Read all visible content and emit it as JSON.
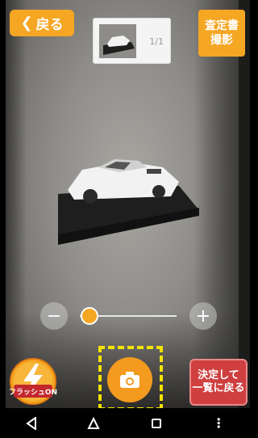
{
  "header": {
    "back_label": "戻る",
    "back_icon": "chevron-left-icon",
    "thumbnail_count": "1/1",
    "assess_photo_label": "査定書\n撮影"
  },
  "zoom": {
    "minus_label": "−",
    "plus_label": "+",
    "level": 0.1
  },
  "bottom": {
    "flash_label": "フラッシュON",
    "shutter_icon": "camera-icon",
    "confirm_label": "決定して\n一覧に戻る"
  },
  "colors": {
    "accent": "#f5a623",
    "confirm": "#cf3f3f",
    "highlight": "#f3e200"
  },
  "navbar": {
    "icons": [
      "back-triangle-icon",
      "home-circle-icon",
      "recents-square-icon",
      "more-dots-icon"
    ]
  }
}
